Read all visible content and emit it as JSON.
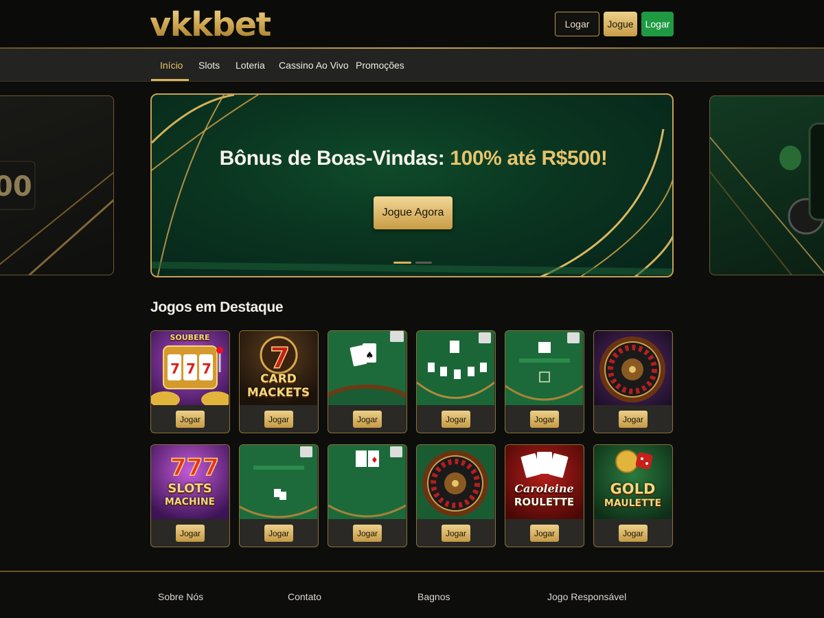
{
  "header": {
    "logo": "vkkbet",
    "login_label": "Logar",
    "play_label": "Jogue",
    "login_label_2": "Logar"
  },
  "nav": {
    "items": [
      {
        "label": "Início",
        "active": true
      },
      {
        "label": "Slots"
      },
      {
        "label": "Loteria"
      },
      {
        "label": "Cassino Ao Vivo"
      },
      {
        "label": "Promoções"
      }
    ]
  },
  "hero": {
    "title_white": "Bônus de Boas-Vindas:",
    "title_gold": "100% até R$500!",
    "cta_label": "Jogue Agora",
    "slide_count": 2,
    "active_slide": 1
  },
  "featured": {
    "title": "Jogos em Destaque",
    "button_label": "Jogar",
    "games": [
      {
        "art": "slot-777",
        "caption_lines": [
          "SOUBERE"
        ]
      },
      {
        "art": "card-7",
        "caption_lines": [
          "CARD",
          "MACKETS"
        ]
      },
      {
        "art": "blackjack-table"
      },
      {
        "art": "blackjack-table"
      },
      {
        "art": "blackjack-table"
      },
      {
        "art": "roulette-wheel"
      },
      {
        "art": "slot-777",
        "caption_lines": [
          "SLOTS",
          "MACHINE"
        ]
      },
      {
        "art": "blackjack-table"
      },
      {
        "art": "blackjack-table"
      },
      {
        "art": "roulette-wheel"
      },
      {
        "art": "cards-roulette",
        "caption_lines": [
          "Caroleine",
          "ROULETTE"
        ]
      },
      {
        "art": "dice-gold",
        "caption_lines": [
          "GOLD",
          "MAULETTE"
        ]
      }
    ]
  },
  "footer": {
    "columns": [
      {
        "heading": "Sobre Nós"
      },
      {
        "heading": "Contato"
      },
      {
        "heading": "Bagnos"
      },
      {
        "heading": "Jogo Responsável"
      }
    ]
  },
  "colors": {
    "background": "#0d0d0c",
    "gold": "#d7b35c",
    "green_button": "#1f9a43",
    "hero_green": "#0a3520"
  }
}
